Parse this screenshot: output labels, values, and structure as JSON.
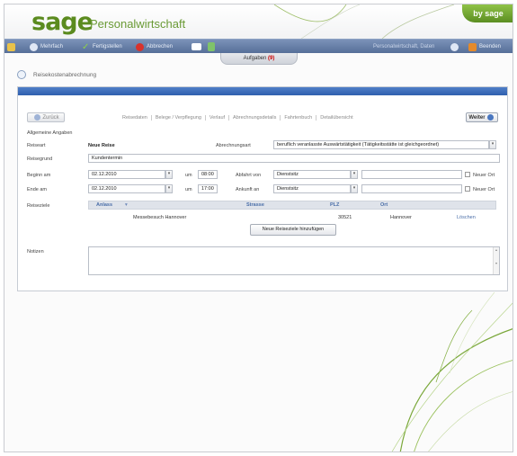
{
  "header": {
    "logo": "sage",
    "title": "Personalwirtschaft",
    "badge": "by sage"
  },
  "toolbar": {
    "back": "Mehrfach",
    "done": "Fertigstellen",
    "cancel": "Abbrechen",
    "person": "Personalwirtschaft, Daten",
    "close": "Beenden"
  },
  "tab": {
    "label": "Aufgaben",
    "count": "(9)"
  },
  "breadcrumb": "Reisekostenabrechnung",
  "wizard": {
    "back_label": "Zurück",
    "next_label": "Weiter",
    "steps": [
      "Reisedaten",
      "Belege / Verpflegung",
      "Verlauf",
      "Abrechnungsdetails",
      "Fahrtenbuch",
      "Detailübersicht"
    ]
  },
  "form": {
    "section_title": "Allgemeine Angaben",
    "reiseart_label": "Reiseart",
    "reiseart_value": "Neue Reise",
    "abrechnung_label": "Abrechnungsart",
    "abrechnung_value": "beruflich veranlasste Auswärtstätigkeit (Tätigkeitsstätte ist gleichgeordnet)",
    "reisegrund_label": "Reisegrund",
    "reisegrund_value": "Kundentermin",
    "beginn_label": "Beginn am",
    "beginn_date": "02.12.2010",
    "beginn_um_label": "um",
    "beginn_time": "08:00",
    "abfahrt_label": "Abfahrt von",
    "abfahrt_value": "Dienstsitz",
    "ende_label": "Ende am",
    "ende_date": "02.12.2010",
    "ende_um_label": "um",
    "ende_time": "17:00",
    "ankunft_label": "Ankunft an",
    "ankunft_value": "Dienstsitz",
    "neuer_ort": "Neuer Ort",
    "reiseziele_label": "Reiseziele",
    "table": {
      "headers": [
        "Anlass",
        "Strasse",
        "PLZ",
        "Ort"
      ],
      "row": {
        "anlass": "Messebesuch Hannover",
        "plz": "30521",
        "ort": "Hannover",
        "action": "Löschen"
      }
    },
    "add_button": "Neue Reiseziele hinzufügen",
    "notizen_label": "Notizen"
  }
}
